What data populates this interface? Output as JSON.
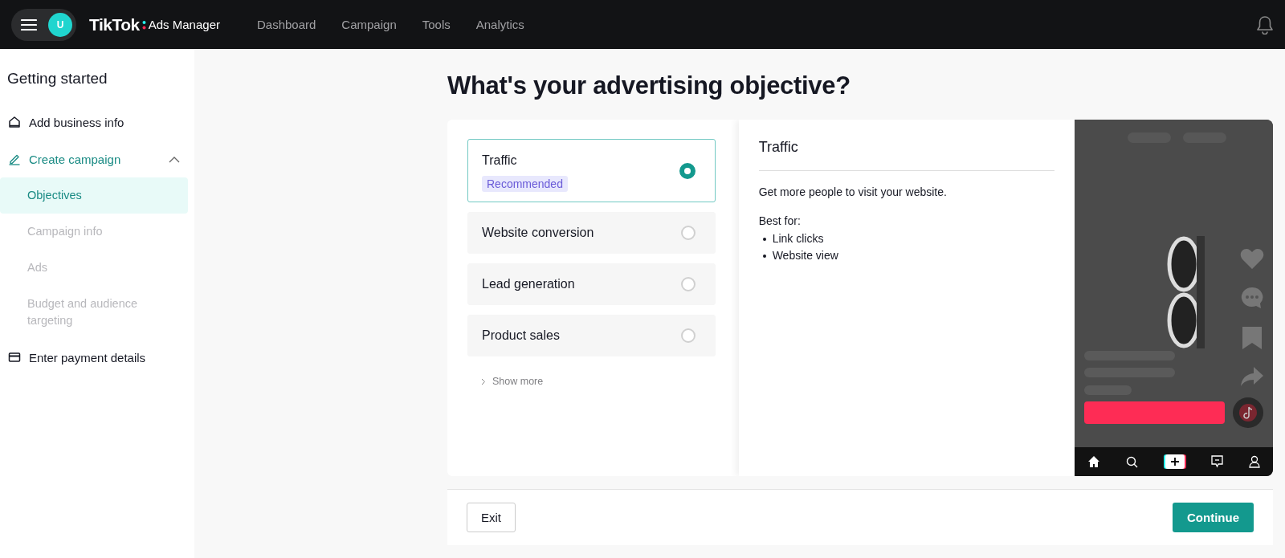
{
  "topbar": {
    "avatar": "U",
    "logo": "TikTok",
    "logo_suffix": "Ads Manager",
    "nav": [
      {
        "label": "Dashboard"
      },
      {
        "label": "Campaign"
      },
      {
        "label": "Tools"
      },
      {
        "label": "Analytics"
      }
    ]
  },
  "sidebar": {
    "title": "Getting started",
    "steps": [
      {
        "label": "Add business info",
        "selected": false
      },
      {
        "label": "Create campaign",
        "selected": true,
        "expanded": true,
        "children": [
          {
            "label": "Objectives",
            "selected": true,
            "disabled": false
          },
          {
            "label": "Campaign info",
            "selected": false,
            "disabled": true
          },
          {
            "label": "Ads",
            "selected": false,
            "disabled": true
          },
          {
            "label": "Budget and audience targeting",
            "selected": false,
            "disabled": true
          }
        ]
      },
      {
        "label": "Enter payment details",
        "selected": false
      }
    ]
  },
  "page_title": "What's your advertising objective?",
  "objectives": [
    {
      "label": "Traffic",
      "selected": true,
      "badge": "Recommended"
    },
    {
      "label": "Website conversion",
      "selected": false
    },
    {
      "label": "Lead generation",
      "selected": false
    },
    {
      "label": "Product sales",
      "selected": false
    }
  ],
  "show_more": "Show more",
  "detail": {
    "title": "Traffic",
    "description": "Get more people to visit your website.",
    "best_for_label": "Best for:",
    "best_for": [
      "Link clicks",
      "Website view"
    ]
  },
  "footer": {
    "exit": "Exit",
    "continue": "Continue"
  }
}
